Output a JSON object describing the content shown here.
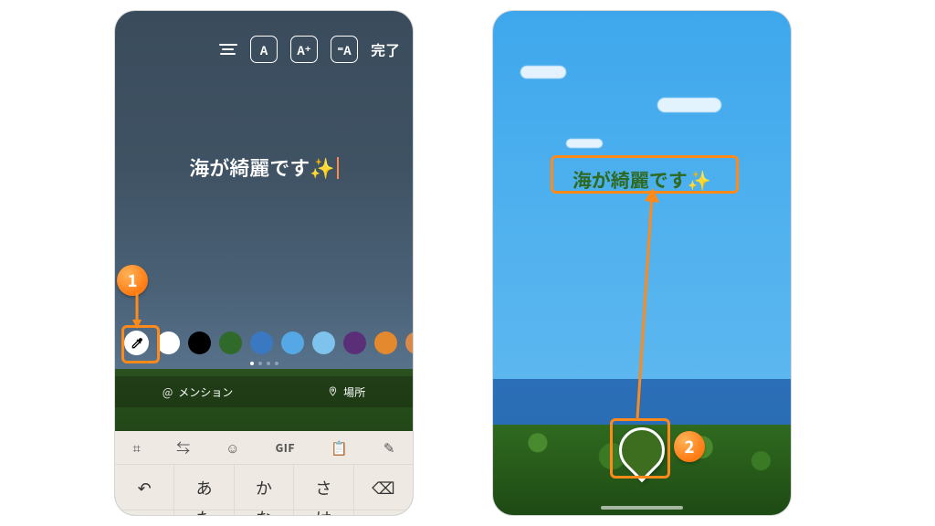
{
  "annotations": {
    "badge1": "1",
    "badge2": "2"
  },
  "left": {
    "toolbar": {
      "font_style_label": "A",
      "font_size_label": "A⁺",
      "bg_toggle_label": "⁼A",
      "done": "完了"
    },
    "text": "海が綺麗です",
    "sparkle": "✨",
    "palette": {
      "eyedropper_icon": "eyedropper",
      "colors": [
        "#ffffff",
        "#000000",
        "#2f6a2a",
        "#3a78c2",
        "#56a7e6",
        "#7dc3ee",
        "#5a2f78",
        "#e5892e",
        "#d98a4b"
      ]
    },
    "chips": {
      "mention_icon": "@",
      "mention_label": "メンション",
      "location_icon": "📍",
      "location_label": "場所"
    },
    "keyboard": {
      "tool_grid": "⌗",
      "tool_arrows": "⇆",
      "tool_sticker": "☺",
      "tool_gif": "GIF",
      "tool_clipboard": "📋",
      "tool_pen": "✎",
      "row1": [
        "↶",
        "あ",
        "か",
        "さ",
        "⌫"
      ],
      "row2": [
        "",
        "た",
        "な",
        "は",
        ""
      ]
    }
  },
  "right": {
    "text": "海が綺麗です",
    "sparkle": "✨",
    "picker_color": "#3d6e20"
  }
}
